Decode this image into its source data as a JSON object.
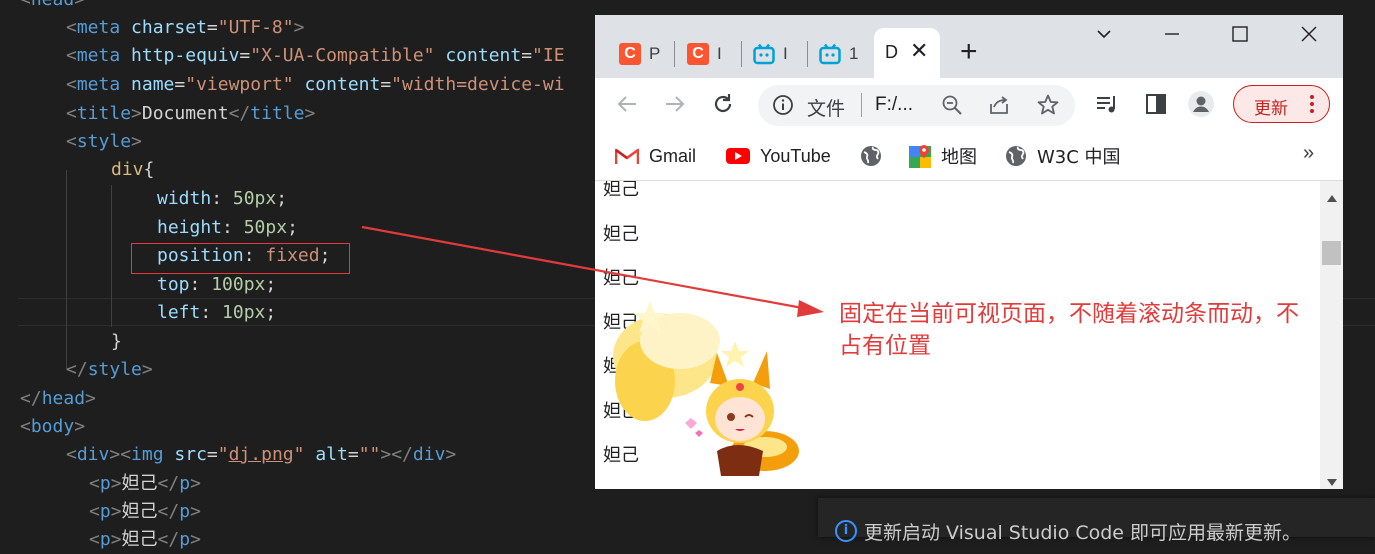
{
  "editor": {
    "lines": {
      "head_open": "<head>",
      "meta_charset_attr": "charset",
      "meta_charset_val": "\"UTF-8\"",
      "meta_compat_attr1": "http-equiv",
      "meta_compat_val1": "\"X-UA-Compatible\"",
      "meta_compat_attr2": "content",
      "meta_compat_val2": "\"IE",
      "meta_viewport_attr1": "name",
      "meta_viewport_val1": "\"viewport\"",
      "meta_viewport_attr2": "content",
      "meta_viewport_val2": "\"width=device-wi",
      "title_text": "Document",
      "selector": "div",
      "width_prop": "width",
      "width_val": "50px",
      "height_prop": "height",
      "height_val": "50px",
      "position_prop": "position",
      "position_val": "fixed",
      "top_prop": "top",
      "top_val": "100px",
      "left_prop": "left",
      "left_val": "10px",
      "img_src": "\"dj.png\"",
      "img_alt": "\"\"",
      "p_text": "妲己"
    }
  },
  "browser": {
    "tabs": [
      {
        "icon": "C",
        "title": "P",
        "color": "#fc5531"
      },
      {
        "icon": "C",
        "title": "I",
        "color": "#fc5531"
      },
      {
        "icon": "bilibili",
        "title": "I",
        "color": "#00a1d6"
      },
      {
        "icon": "bilibili",
        "title": "1",
        "color": "#00a1d6"
      }
    ],
    "active_tab": {
      "title": "D",
      "close": "✕"
    },
    "new_tab": "+",
    "address": {
      "scheme_label": "文件",
      "url": "F:/..."
    },
    "update_label": "更新",
    "bookmarks": [
      {
        "label": "Gmail",
        "icon": "gmail-icon"
      },
      {
        "label": "YouTube",
        "icon": "youtube-icon"
      },
      {
        "label": "",
        "icon": "globe-icon"
      },
      {
        "label": "地图",
        "icon": "maps-icon"
      },
      {
        "label": "W3C 中国",
        "icon": "globe-icon"
      }
    ],
    "bookmarks_more": "»",
    "paragraphs": [
      "妲己",
      "妲己",
      "妲己",
      "妲己",
      "妲己",
      "妲己",
      "妲己"
    ]
  },
  "annotation": "固定在当前可视页面，不随着滚动条而动，不占有位置",
  "notification": {
    "message": "更新启动 Visual Studio Code 即可应用最新更新。"
  },
  "colors": {
    "annotation_red": "#e23b3b",
    "editor_bg": "#1e1e1e",
    "tag_blue": "#569cd6"
  }
}
